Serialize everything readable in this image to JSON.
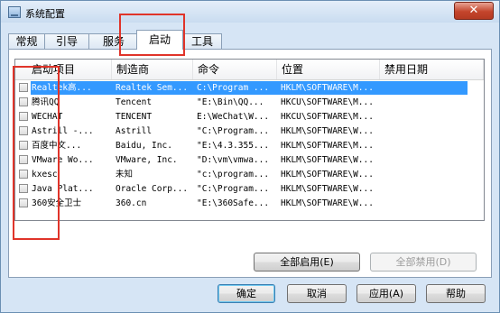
{
  "window": {
    "title": "系统配置",
    "close_symbol": "✕",
    "accent": "#3399ff"
  },
  "tabs": [
    {
      "label": "常规"
    },
    {
      "label": "引导"
    },
    {
      "label": "服务"
    },
    {
      "label": "启动"
    },
    {
      "label": "工具"
    }
  ],
  "list": {
    "columns": [
      "启动项目",
      "制造商",
      "命令",
      "位置",
      "禁用日期"
    ],
    "rows": [
      {
        "item": "Realtek高...",
        "maker": "Realtek Sem...",
        "command": "C:\\Program ...",
        "location": "HKLM\\SOFTWARE\\M...",
        "disabled": "",
        "checked": false
      },
      {
        "item": "腾讯QQ",
        "maker": "Tencent",
        "command": "\"E:\\Bin\\QQ...",
        "location": "HKCU\\SOFTWARE\\M...",
        "disabled": "",
        "checked": false
      },
      {
        "item": "WECHAT",
        "maker": "TENCENT",
        "command": "E:\\WeChat\\W...",
        "location": "HKCU\\SOFTWARE\\M...",
        "disabled": "",
        "checked": false
      },
      {
        "item": "Astrill -...",
        "maker": "Astrill",
        "command": "\"C:\\Program...",
        "location": "HKLM\\SOFTWARE\\W...",
        "disabled": "",
        "checked": false
      },
      {
        "item": "百度中文...",
        "maker": "Baidu, Inc.",
        "command": "\"E:\\4.3.355...",
        "location": "HKLM\\SOFTWARE\\M...",
        "disabled": "",
        "checked": false
      },
      {
        "item": "VMware Wo...",
        "maker": "VMware, Inc.",
        "command": "\"D:\\vm\\vmwa...",
        "location": "HKLM\\SOFTWARE\\W...",
        "disabled": "",
        "checked": false
      },
      {
        "item": "kxesc",
        "maker": "未知",
        "command": "\"c:\\program...",
        "location": "HKLM\\SOFTWARE\\W...",
        "disabled": "",
        "checked": false
      },
      {
        "item": "Java Plat...",
        "maker": "Oracle Corp...",
        "command": "\"C:\\Program...",
        "location": "HKLM\\SOFTWARE\\W...",
        "disabled": "",
        "checked": false
      },
      {
        "item": "360安全卫士",
        "maker": "360.cn",
        "command": "\"E:\\360Safe...",
        "location": "HKLM\\SOFTWARE\\W...",
        "disabled": "",
        "checked": false
      }
    ]
  },
  "buttons": {
    "enable_all": "全部启用(E)",
    "disable_all": "全部禁用(D)",
    "ok": "确定",
    "cancel": "取消",
    "apply": "应用(A)",
    "help": "帮助"
  }
}
